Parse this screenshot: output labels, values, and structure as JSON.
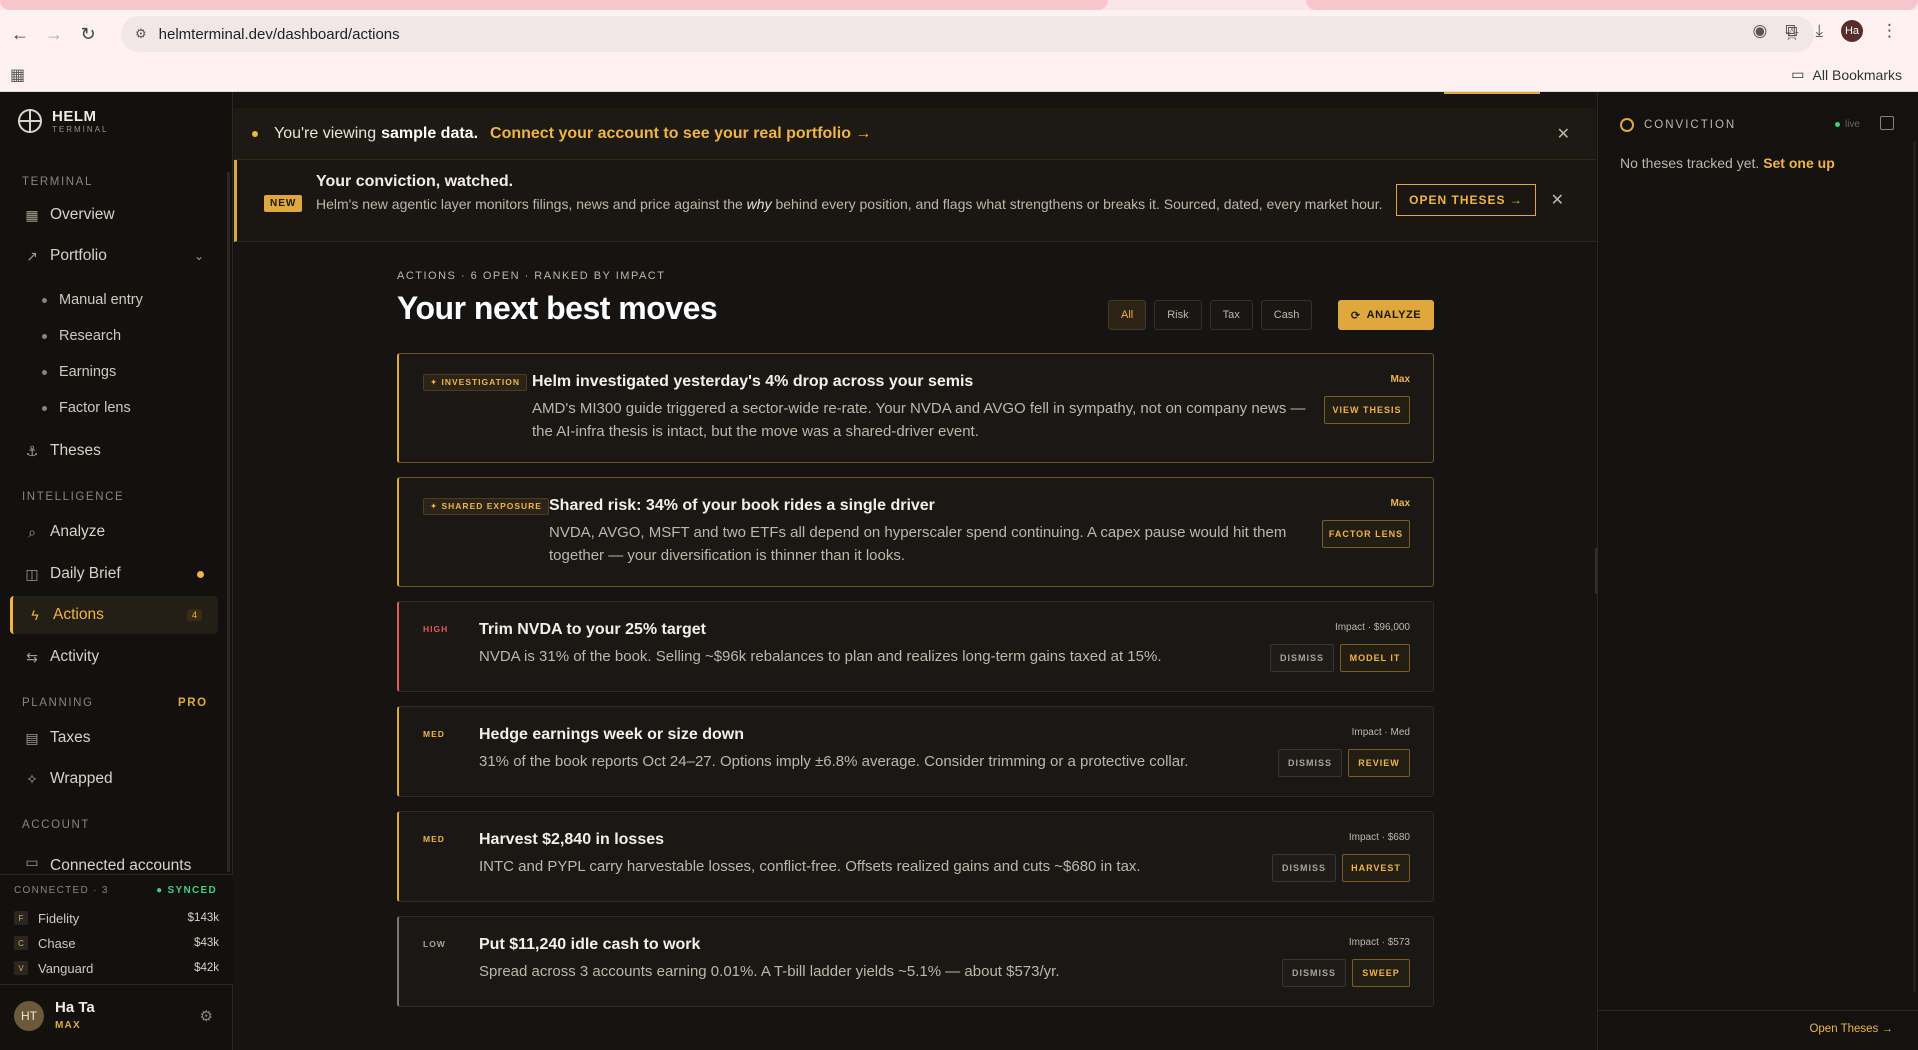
{
  "browser": {
    "url": "helmterminal.dev/dashboard/actions",
    "avatar_initials": "Ha",
    "bookmarks_label": "All Bookmarks"
  },
  "sidebar": {
    "brand_name": "HELM",
    "brand_sub": "TERMINAL",
    "sections": {
      "terminal": "TERMINAL",
      "intelligence": "INTELLIGENCE",
      "planning": "PLANNING",
      "planning_badge": "PRO",
      "account": "ACCOUNT"
    },
    "items": {
      "overview": "Overview",
      "portfolio": "Portfolio",
      "manual_entry": "Manual entry",
      "research": "Research",
      "earnings": "Earnings",
      "factor_lens": "Factor lens",
      "theses": "Theses",
      "analyze": "Analyze",
      "daily_brief": "Daily Brief",
      "actions": "Actions",
      "actions_count": "4",
      "activity": "Activity",
      "taxes": "Taxes",
      "wrapped": "Wrapped",
      "connected_accounts": "Connected accounts"
    },
    "connected": {
      "header": "CONNECTED · 3",
      "status": "● SYNCED",
      "accounts": [
        {
          "badge": "F",
          "name": "Fidelity",
          "amount": "$143k"
        },
        {
          "badge": "C",
          "name": "Chase",
          "amount": "$43k"
        },
        {
          "badge": "V",
          "name": "Vanguard",
          "amount": "$42k"
        }
      ]
    },
    "user": {
      "initials": "HT",
      "name": "Ha Ta",
      "tier": "MAX"
    }
  },
  "banner": {
    "prefix": "You're viewing",
    "bold": "sample data.",
    "link": "Connect your account to see your real portfolio →"
  },
  "new_banner": {
    "badge": "NEW",
    "title": "Your conviction, watched.",
    "body_1": "Helm's new agentic layer monitors filings, news and price against the",
    "body_em": "why",
    "body_2": "behind every position, and flags what strengthens or breaks it. Sourced, dated, every market hour.",
    "button": "OPEN THESES →"
  },
  "actions": {
    "kicker": "ACTIONS · 6 OPEN · RANKED BY IMPACT",
    "title": "Your next best moves",
    "filters": [
      "All",
      "Risk",
      "Tax",
      "Cash"
    ],
    "analyze": "ANALYZE",
    "cards": [
      {
        "tag": "✦ INVESTIGATION",
        "title": "Helm investigated yesterday's 4% drop across your semis",
        "body": "AMD's MI300 guide triggered a sector-wide re-rate. Your NVDA and AVGO fell in sympathy, not on company news — the AI-infra thesis is intact, but the move was a shared-driver event.",
        "impact": "Max",
        "action": "VIEW THESIS"
      },
      {
        "tag": "✦ SHARED EXPOSURE",
        "title": "Shared risk: 34% of your book rides a single driver",
        "body": "NVDA, AVGO, MSFT and two ETFs all depend on hyperscaler spend continuing. A capex pause would hit them together — your diversification is thinner than it looks.",
        "impact": "Max",
        "action": "FACTOR LENS"
      },
      {
        "tag": "HIGH",
        "title": "Trim NVDA to your 25% target",
        "body": "NVDA is 31% of the book. Selling ~$96k rebalances to plan and realizes long-term gains taxed at 15%.",
        "impact": "Impact · $96,000",
        "dismiss": "DISMISS",
        "action": "MODEL IT"
      },
      {
        "tag": "MED",
        "title": "Hedge earnings week or size down",
        "body": "31% of the book reports Oct 24–27. Options imply ±6.8% average. Consider trimming or a protective collar.",
        "impact": "Impact · Med",
        "dismiss": "DISMISS",
        "action": "REVIEW"
      },
      {
        "tag": "MED",
        "title": "Harvest $2,840 in losses",
        "body": "INTC and PYPL carry harvestable losses, conflict-free. Offsets realized gains and cuts ~$680 in tax.",
        "impact": "Impact · $680",
        "dismiss": "DISMISS",
        "action": "HARVEST"
      },
      {
        "tag": "LOW",
        "title": "Put $11,240 idle cash to work",
        "body": "Spread across 3 accounts earning 0.01%. A T-bill ladder yields ~5.1% — about $573/yr.",
        "impact": "Impact · $573",
        "dismiss": "DISMISS",
        "action": "SWEEP"
      }
    ]
  },
  "right_panel": {
    "title": "CONVICTION",
    "live": "live",
    "empty": "No theses tracked yet.",
    "empty_link": "Set one up",
    "footer": "Open Theses →"
  }
}
